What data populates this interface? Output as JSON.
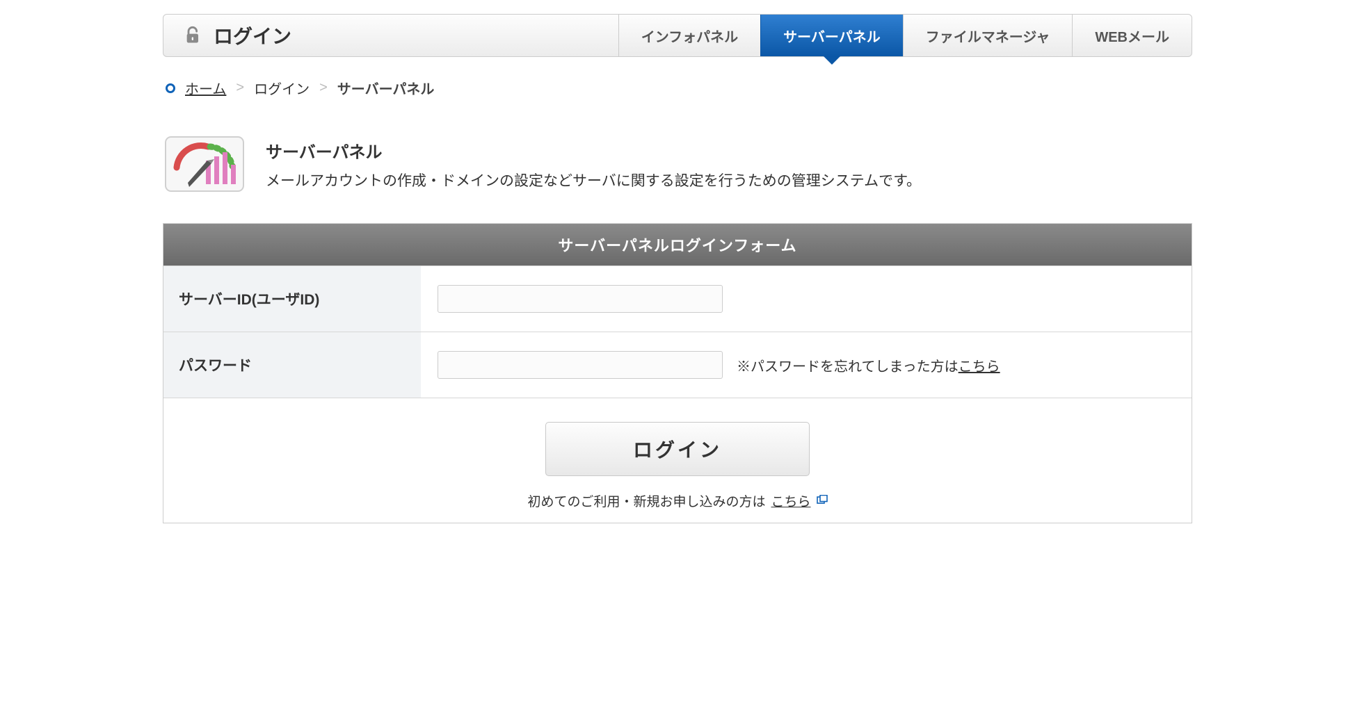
{
  "header": {
    "title": "ログイン",
    "tabs": [
      {
        "label": "インフォパネル",
        "active": false
      },
      {
        "label": "サーバーパネル",
        "active": true
      },
      {
        "label": "ファイルマネージャ",
        "active": false
      },
      {
        "label": "WEBメール",
        "active": false
      }
    ]
  },
  "breadcrumb": {
    "home": "ホーム",
    "sep": ">",
    "login": "ログイン",
    "current": "サーバーパネル"
  },
  "intro": {
    "heading": "サーバーパネル",
    "description": "メールアカウントの作成・ドメインの設定などサーバに関する設定を行うための管理システムです。"
  },
  "form": {
    "header": "サーバーパネルログインフォーム",
    "server_id_label": "サーバーID(ユーザID)",
    "server_id_value": "",
    "password_label": "パスワード",
    "password_value": "",
    "forgot_prefix": "※パスワードを忘れてしまった方は",
    "forgot_link": "こちら",
    "submit_label": "ログイン",
    "signup_prefix": "初めてのご利用・新規お申し込みの方は",
    "signup_link": "こちら"
  },
  "colors": {
    "brand_blue": "#0b57a6"
  }
}
